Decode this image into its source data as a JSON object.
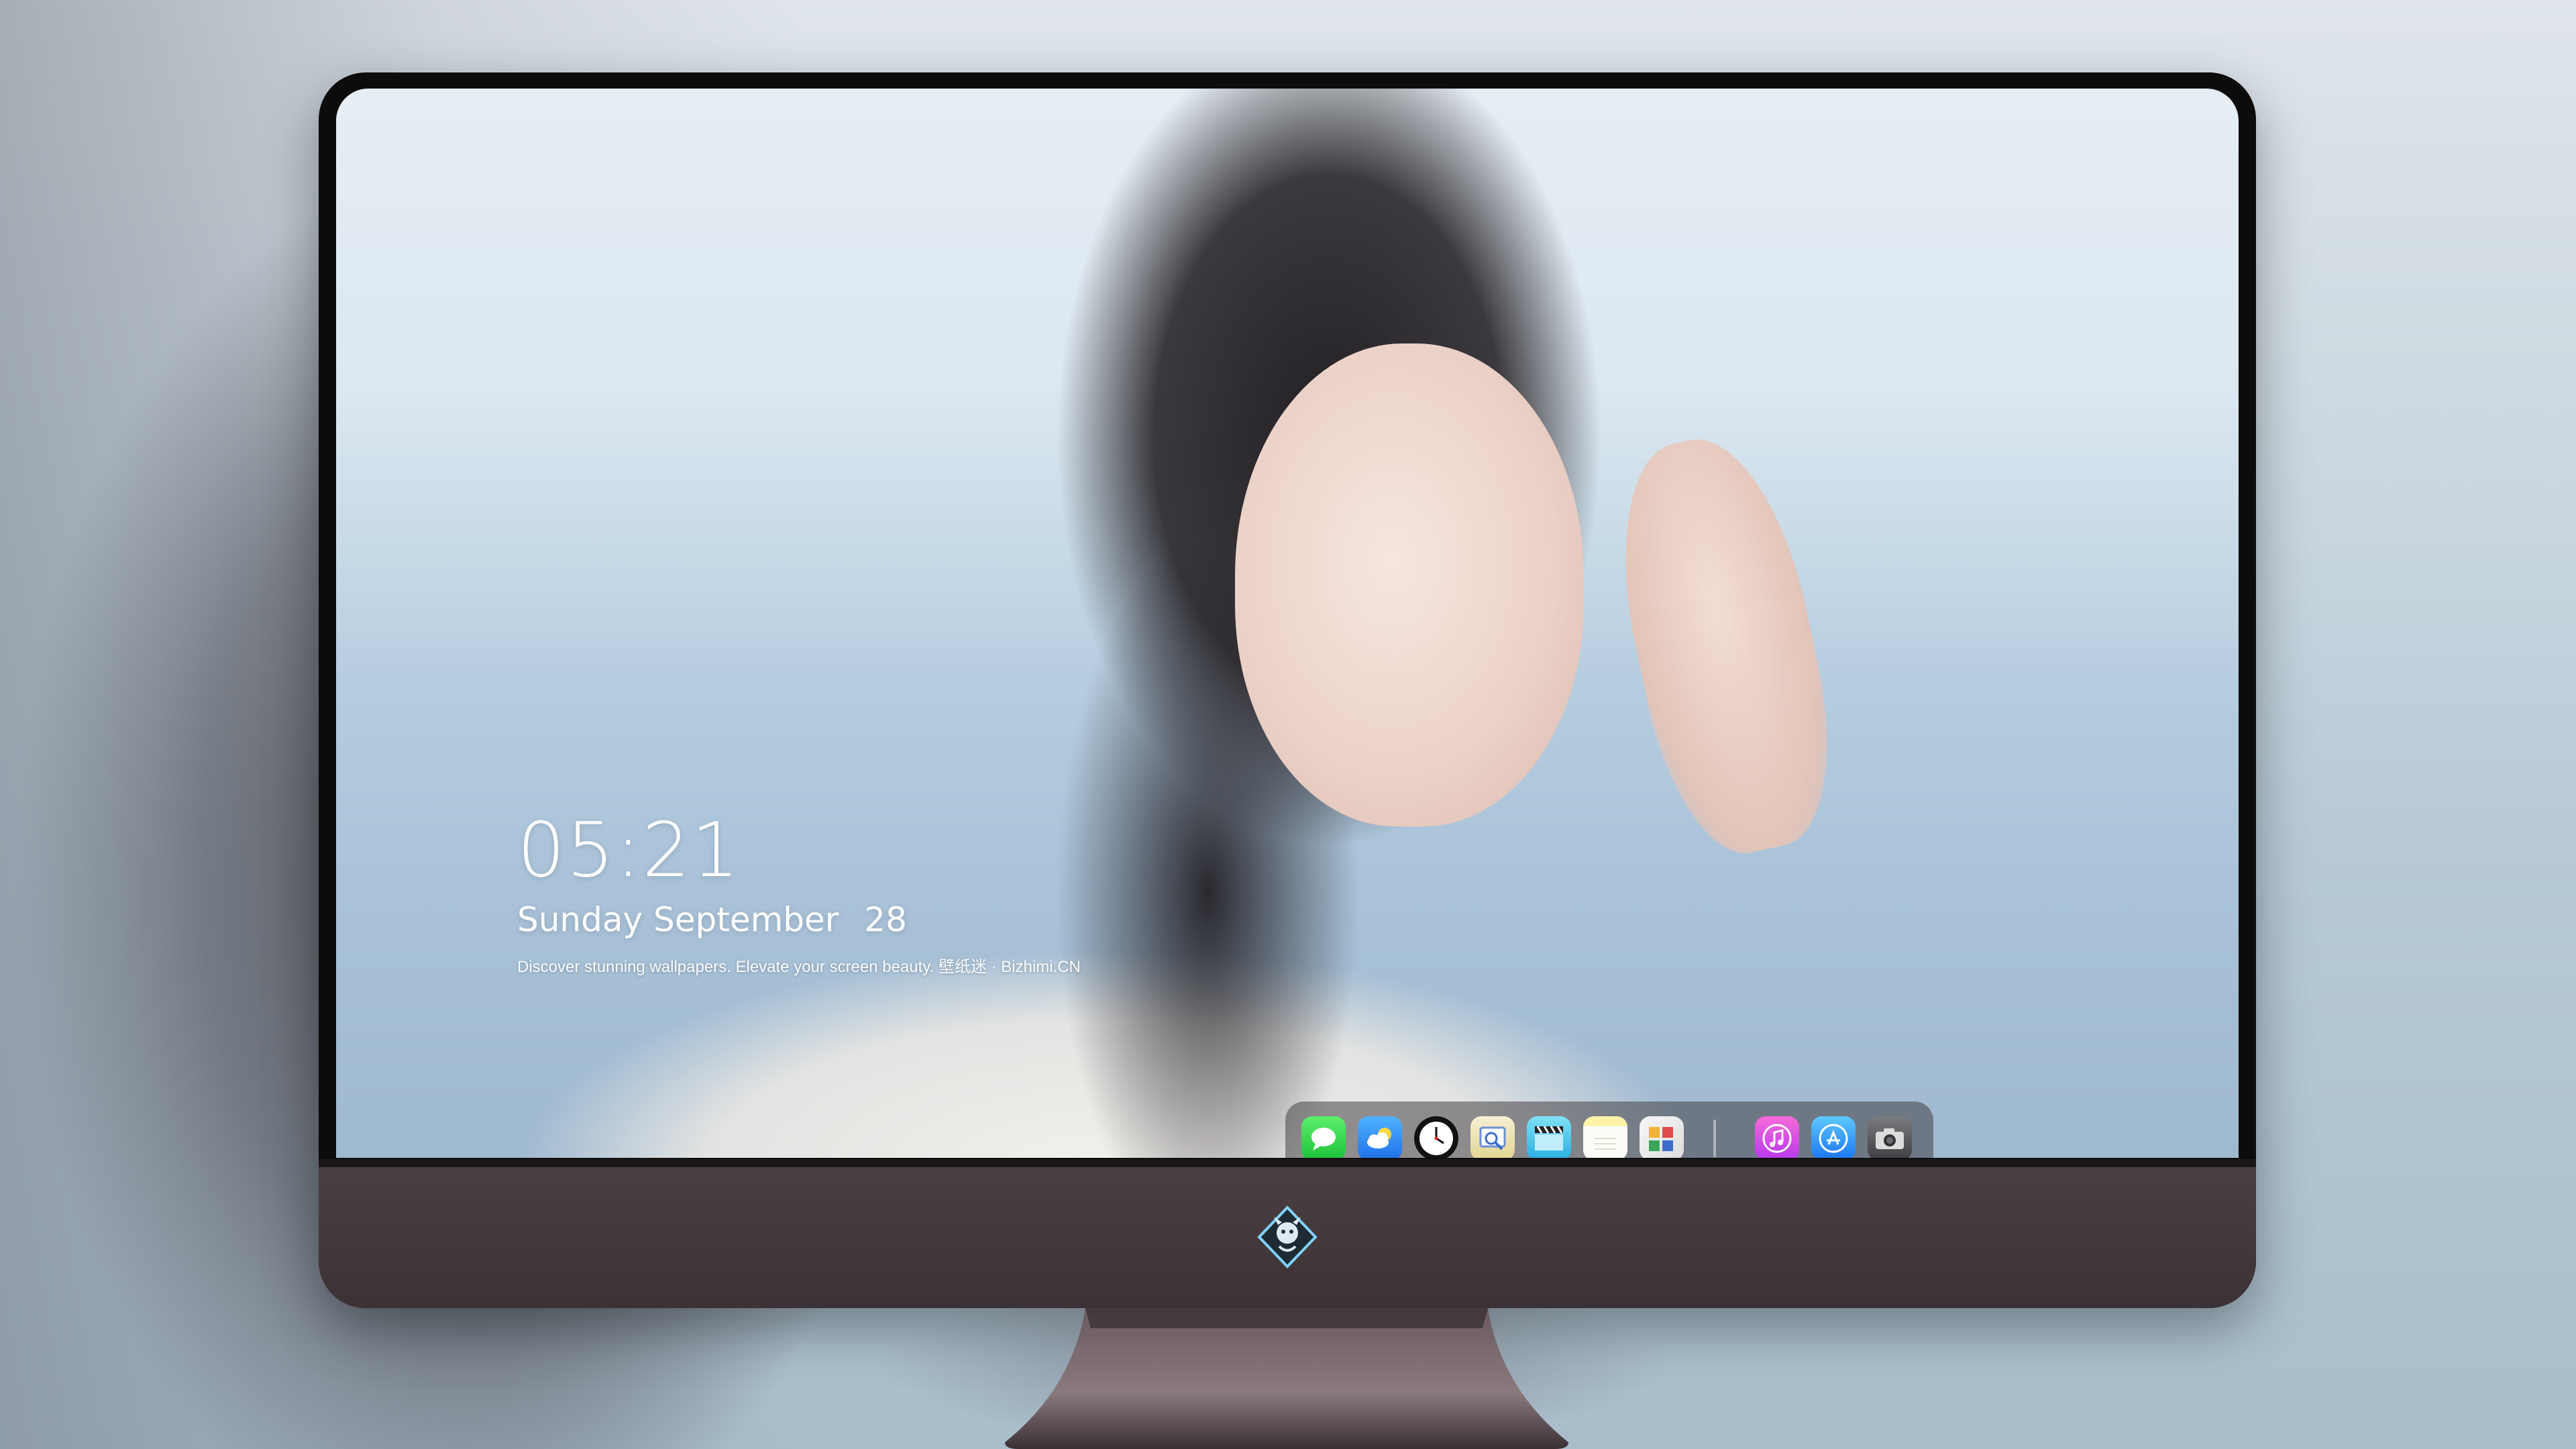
{
  "lock_screen": {
    "time": "05:21",
    "day": "Sunday",
    "month": "September",
    "day_number": "28",
    "tagline": "Discover stunning wallpapers. Elevate your screen beauty. 壁纸迷 · Bizhimi.CN"
  },
  "dock": {
    "left_icons": [
      {
        "icon": "messages-icon",
        "color": "#1dc13a"
      },
      {
        "icon": "weather-icon",
        "color": "#1f6fe8"
      },
      {
        "icon": "clock-icon",
        "color": "#111111"
      },
      {
        "icon": "preview-icon",
        "color": "#e1d48f"
      },
      {
        "icon": "video-clapper-icon",
        "color": "#29aee0"
      },
      {
        "icon": "notes-icon",
        "color": "#fff3a8"
      },
      {
        "icon": "photos-icon",
        "color": "#dcdcdc"
      }
    ],
    "right_icons": [
      {
        "icon": "music-icon",
        "color": "#b637ea"
      },
      {
        "icon": "app-store-icon",
        "color": "#1a74f0"
      },
      {
        "icon": "camera-icon",
        "color": "#3d3d42"
      }
    ]
  },
  "monitor": {
    "logo": "dragon-emblem-logo",
    "bezel_color": "#0d0c0d",
    "chin_color": "#4a3f43"
  }
}
